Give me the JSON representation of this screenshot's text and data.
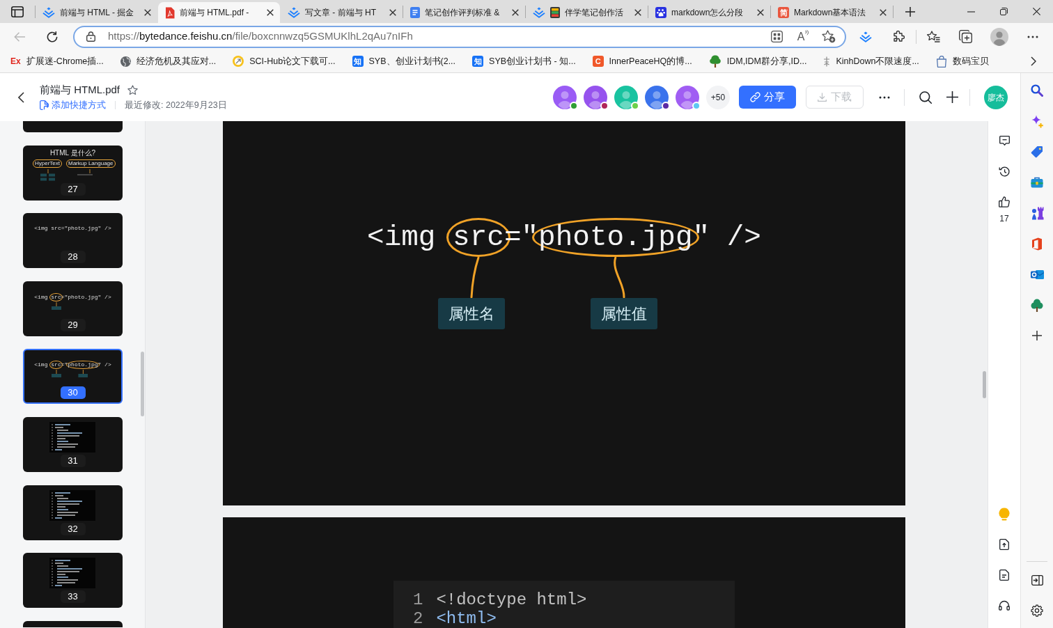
{
  "browser": {
    "tabs": [
      {
        "kind": "chevron",
        "title": "前端与 HTML - 掘金",
        "selected": false
      },
      {
        "kind": "pdf",
        "title": "前端与 HTML.pdf -",
        "selected": true
      },
      {
        "kind": "chevron",
        "title": "写文章 - 前端与 HT",
        "selected": false
      },
      {
        "kind": "doc",
        "title": "笔记创作评判标准 &",
        "selected": false
      },
      {
        "kind": "chevron-notebook",
        "title": "伴学笔记创作活",
        "selected": false
      },
      {
        "kind": "paw",
        "title": "markdown怎么分段",
        "selected": false
      },
      {
        "kind": "badge",
        "icon_text": "简",
        "color": "#e9573f",
        "title": "Markdown基本语法",
        "selected": false
      }
    ],
    "address": {
      "scheme": "https://",
      "host": "bytedance.feishu.cn",
      "path": "/file/boxcnnwzq5GSMUKlhL2qAu7nIFh",
      "read_aloud_glyph": "A"
    },
    "bookmarks": [
      {
        "kind": "wordmark",
        "icon_text": "Ex",
        "color": "#e0261d",
        "title": "扩展迷-Chrome插..."
      },
      {
        "kind": "globe",
        "title": "经济危机及其应对..."
      },
      {
        "kind": "ring",
        "title": "SCI-Hub论文下载可..."
      },
      {
        "kind": "badge",
        "icon_text": "知",
        "color": "#1772f6",
        "title": "SYB、创业计划书(2..."
      },
      {
        "kind": "badge",
        "icon_text": "知",
        "color": "#1772f6",
        "title": "SYB创业计划书 - 知..."
      },
      {
        "kind": "badge",
        "icon_text": "C",
        "color": "#f0582a",
        "title": "InnerPeaceHQ的博..."
      },
      {
        "kind": "tree",
        "title": "IDM,IDM群分享,ID..."
      },
      {
        "kind": "glyph",
        "title": "KinhDown不限速度..."
      },
      {
        "kind": "bag",
        "title": "数码宝贝"
      }
    ]
  },
  "document": {
    "title": "前端与 HTML.pdf",
    "starred": false,
    "shortcut_link": "添加快捷方式",
    "last_modified": "最近修改: 2022年9月23日",
    "collaborators": [
      {
        "color": "#9a5cf5",
        "status": {
          "color": "#2f9e35"
        }
      },
      {
        "color": "#9653ee",
        "status": {
          "color": "#b0245a"
        }
      },
      {
        "color": "#19c3a0",
        "status": {
          "color": "#6cd04a"
        }
      },
      {
        "color": "#3a72ec",
        "status": {
          "color": "#5a2aa5"
        }
      },
      {
        "color": "#a05df3",
        "status": {
          "color": "#5ec8f2"
        }
      }
    ],
    "more_count": "+50",
    "share_button": {
      "label": "分享"
    },
    "download_button": {
      "label": "下载",
      "disabled": true
    },
    "user_initials": "廖杰"
  },
  "thumbnails": [
    {
      "kind": "cut",
      "selected": false
    },
    {
      "kind": "diagram",
      "number": "27",
      "title": "HTML 是什么?",
      "terms": [
        "HyperText",
        "Markup Language"
      ],
      "selected": false
    },
    {
      "kind": "code",
      "number": "28",
      "code_parts": [
        {
          "text": "<img src=\"photo.jpg\" />",
          "circled": false
        }
      ],
      "selected": false
    },
    {
      "kind": "code",
      "number": "29",
      "code_parts": [
        {
          "text": "<img ",
          "circled": false
        },
        {
          "text": "src",
          "circled": true
        },
        {
          "text": "=\"photo.jpg\" />",
          "circled": false
        }
      ],
      "selected": false
    },
    {
      "kind": "code",
      "number": "30",
      "code_parts": [
        {
          "text": "<img ",
          "circled": false
        },
        {
          "text": "src",
          "circled": true
        },
        {
          "text": "=\"",
          "circled": false
        },
        {
          "text": "photo.jpg",
          "circled": true
        },
        {
          "text": "\" />",
          "circled": false
        }
      ],
      "selected": true
    },
    {
      "kind": "listing",
      "number": "31",
      "selected": false
    },
    {
      "kind": "listing",
      "number": "32",
      "selected": false
    },
    {
      "kind": "listing",
      "number": "33",
      "selected": false
    },
    {
      "kind": "cut",
      "selected": false
    }
  ],
  "slides": [
    {
      "kind": "annotated_code",
      "code_parts": [
        {
          "text": "<img ",
          "circled": false
        },
        {
          "text": "src",
          "circled": true
        },
        {
          "text": "=\"",
          "circled": false
        },
        {
          "text": "photo.jpg",
          "circled": true
        },
        {
          "text": "\" />",
          "circled": false
        }
      ],
      "annotations": [
        {
          "label": "属性名"
        },
        {
          "label": "属性值"
        }
      ]
    },
    {
      "kind": "code_listing",
      "lines": [
        {
          "number": "1",
          "text": "<!doctype html>",
          "kind": "doctype"
        },
        {
          "number": "2",
          "text": "<html>",
          "kind": "tag"
        }
      ]
    }
  ],
  "toolbar": {
    "like_count": "17"
  }
}
